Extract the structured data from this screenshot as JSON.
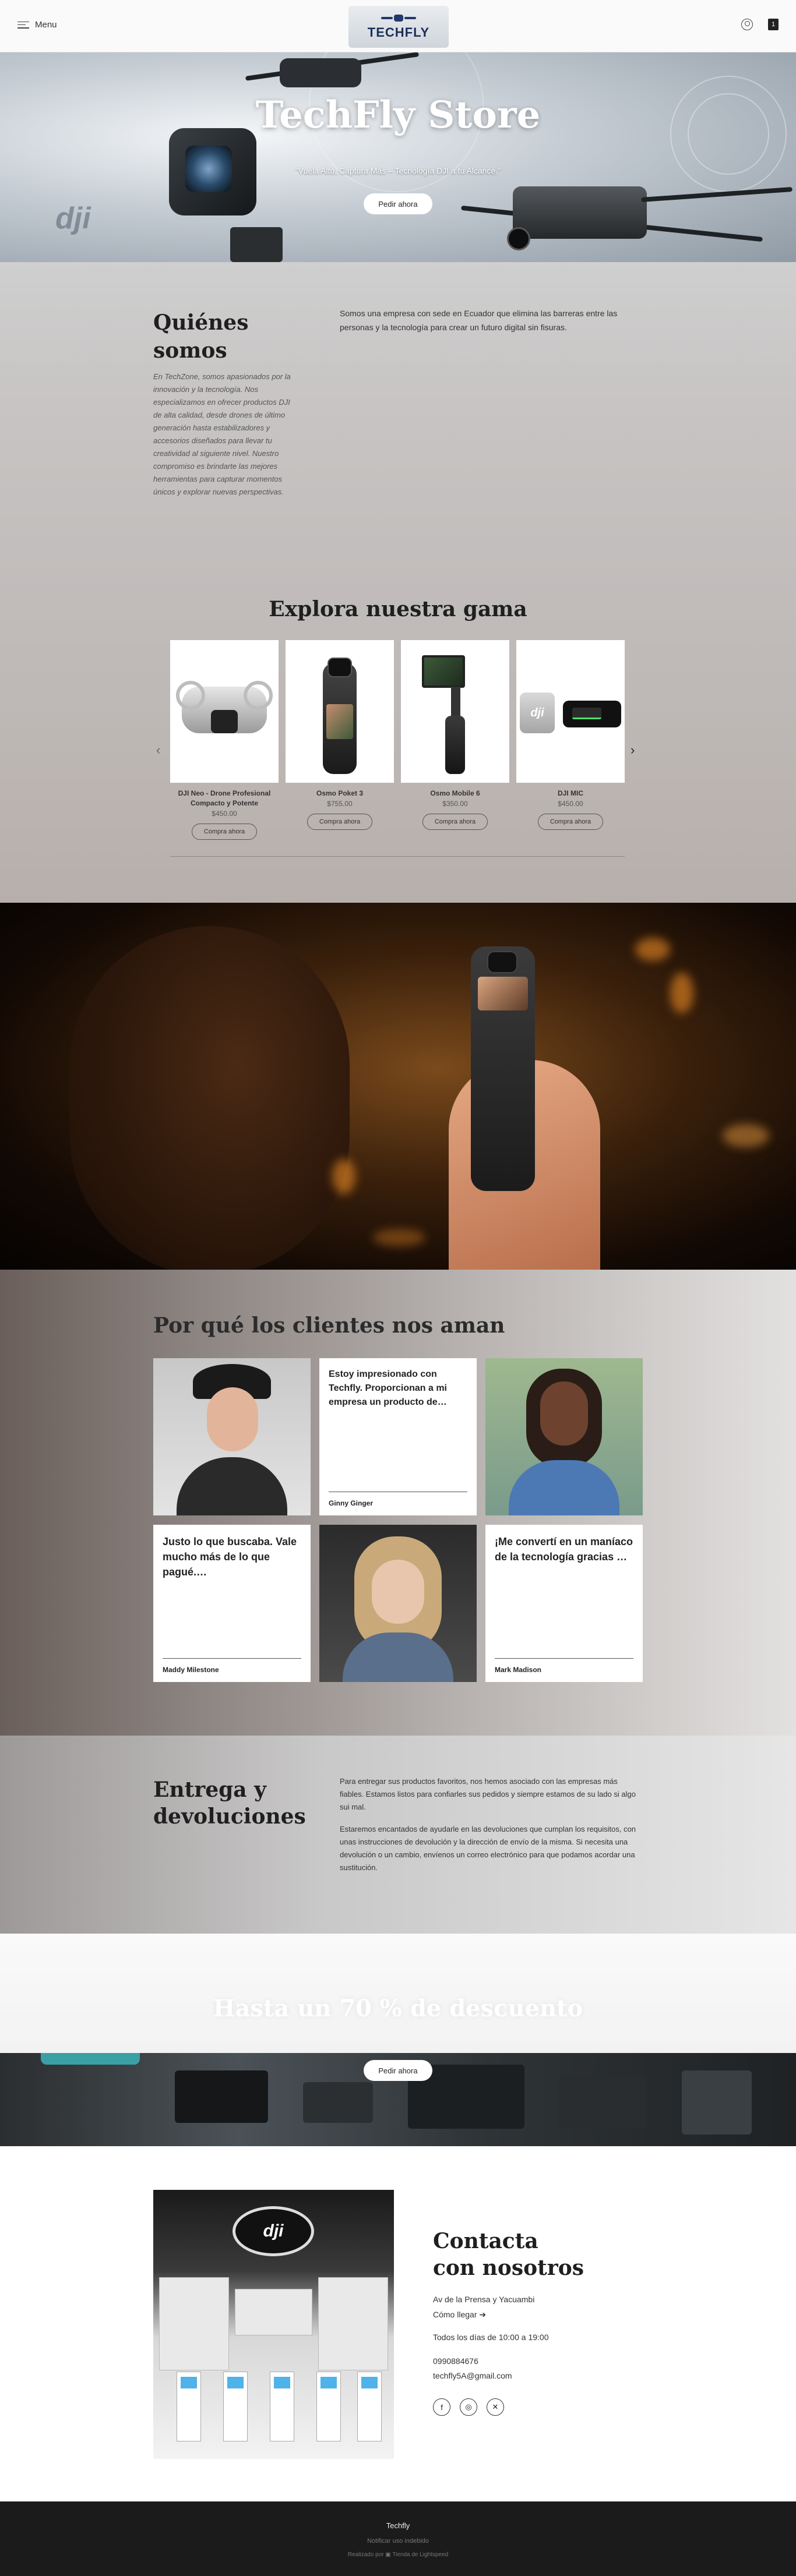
{
  "header": {
    "menu_label": "Menu",
    "logo_text": "TECHFLY",
    "cart_count": "1"
  },
  "hero": {
    "title": "TechFly Store",
    "tagline": "\"Vuela Alto, Captura Más – Tecnología DJI a tu Alcance.\"",
    "cta": "Pedir ahora",
    "brand_mark": "dji"
  },
  "about": {
    "title_line1": "Quiénes",
    "title_line2": "somos",
    "body": "En TechZone, somos apasionados por la innovación y la tecnología. Nos especializamos en ofrecer productos DJI de alta calidad, desde drones de último generación hasta estabilizadores y accesorios diseñados para llevar tu creatividad al siguiente nivel. Nuestro compromiso es brindarte las mejores herramientas para capturar momentos únicos y explorar nuevas perspectivas.",
    "lead": "Somos una empresa con sede en Ecuador que elimina las barreras entre las personas y la tecnología para crear un futuro digital sin fisuras."
  },
  "products": {
    "title": "Explora nuestra gama",
    "items": [
      {
        "name": "DJI Neo - Drone Profesional Compacto y Potente",
        "price": "$450.00",
        "cta": "Compra ahora"
      },
      {
        "name": "Osmo Poket 3",
        "price": "$755.00",
        "cta": "Compra ahora"
      },
      {
        "name": "Osmo Mobile 6",
        "price": "$350.00",
        "cta": "Compra ahora"
      },
      {
        "name": "DJI MIC",
        "price": "$450.00",
        "cta": "Compra ahora"
      }
    ],
    "mic_brand": "dji"
  },
  "testimonials": {
    "title": "Por qué los clientes nos aman",
    "items": [
      {
        "quote": "Estoy impresionado con Techfly. Proporcionan a mi empresa un producto de…",
        "author": "Ginny Ginger"
      },
      {
        "quote": "Justo lo que buscaba. Vale mucho más de lo que pagué.…",
        "author": "Maddy Milestone"
      },
      {
        "quote": "¡Me convertí en un maníaco de la tecnología gracias …",
        "author": "Mark Madison"
      }
    ]
  },
  "delivery": {
    "title_line1": "Entrega y",
    "title_line2": "devoluciones",
    "p1": "Para entregar sus productos favoritos, nos hemos asociado con las empresas más fiables. Estamos listos para confiarles sus pedidos y siempre estamos de su lado si algo sui mal.",
    "p2": "Estaremos encantados de ayudarle en las devoluciones que cumplan los requisitos, con unas instrucciones de devolución y la dirección de envío de la misma. Si necesita una devolución o un cambio, envíenos un correo electrónico para que podamos acordar una sustitución."
  },
  "promo": {
    "title": "Hasta un 70 % de descuento",
    "cta": "Pedir ahora"
  },
  "contact": {
    "title_line1": "Contacta",
    "title_line2": "con nosotros",
    "address": "Av de la Prensa y Yacuambi",
    "directions": "Cómo llegar ➔",
    "hours": "Todos los días de 10:00 a 19:00",
    "phone": "0990884676",
    "email": "techfly5A@gmail.com",
    "store_sign": "dji",
    "socials": [
      "facebook",
      "instagram",
      "x"
    ]
  },
  "footer": {
    "name": "Techfly",
    "report": "Notificar uso indebido",
    "made_by": "Realizado por  ▣  Tienda de Lightspeed"
  },
  "colors": {
    "footer_bg": "#1b1b1b",
    "hero_button_bg": "#ffffff",
    "logo_blue": "#1b2f5a"
  }
}
